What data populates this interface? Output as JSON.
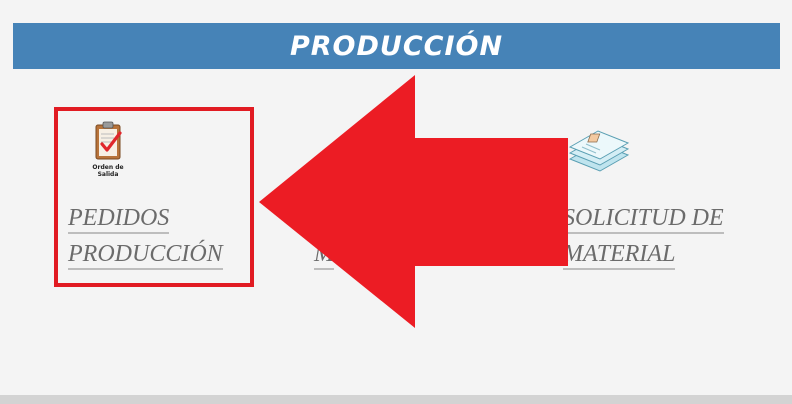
{
  "header": {
    "title": "PRODUCCIÓN"
  },
  "tiles": [
    {
      "label_lines": [
        "PEDIDOS",
        "PRODUCCIÓN"
      ],
      "icon": "clipboard-check-icon",
      "icon_caption_lines": [
        "Orden de",
        "Salida"
      ]
    },
    {
      "label_lines": [
        "M"
      ],
      "icon": "hidden-icon"
    },
    {
      "label_lines": [
        "SOLICITUD DE",
        "MATERIAL"
      ],
      "icon": "documents-stack-icon"
    }
  ],
  "colors": {
    "header_bg": "#4683b7",
    "highlight": "#e11b22",
    "arrow": "#ec1c24",
    "link_text": "#6b6b6b"
  }
}
